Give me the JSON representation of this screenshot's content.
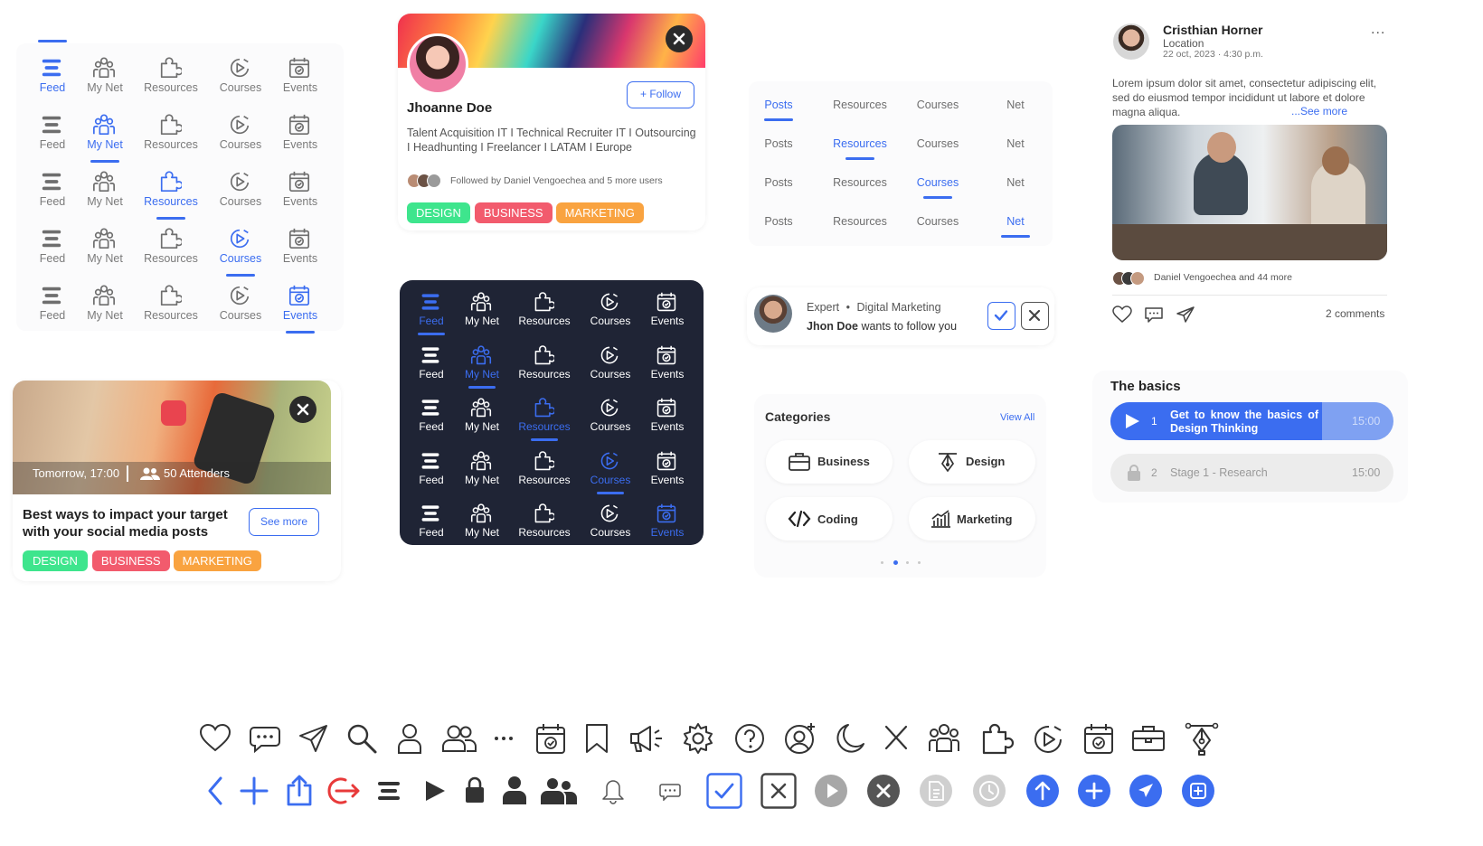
{
  "nav": {
    "labels": [
      "Feed",
      "My Net",
      "Resources",
      "Courses",
      "Events"
    ]
  },
  "profile": {
    "name": "Jhoanne Doe",
    "follow_label": "+ Follow",
    "bio": "Talent Acquisition IT I Technical Recruiter IT I Outsourcing I Headhunting I Freelancer I LATAM I Europe",
    "followed_by": "Followed by Daniel Vengoechea and 5 more users",
    "tags": [
      "DESIGN",
      "BUSINESS",
      "MARKETING"
    ]
  },
  "tabs": {
    "labels": [
      "Posts",
      "Resources",
      "Courses",
      "Net"
    ]
  },
  "follow_request": {
    "role": "Expert",
    "field": "Digital Marketing",
    "name": "Jhon Doe",
    "text": "wants to follow you"
  },
  "categories": {
    "title": "Categories",
    "view_all": "View All",
    "items": [
      "Business",
      "Design",
      "Coding",
      "Marketing"
    ]
  },
  "event": {
    "when": "Tomorrow, 17:00",
    "attendees": "50 Attenders",
    "title": "Best ways to impact your target with your social media posts",
    "see_more": "See more",
    "tags": [
      "DESIGN",
      "BUSINESS",
      "MARKETING"
    ]
  },
  "post": {
    "author": "Cristhian Horner",
    "location": "Location",
    "date": "22 oct, 2023 · 4:30 p.m.",
    "body": "Lorem ipsum dolor sit amet, consectetur adipiscing elit, sed do eiusmod tempor incididunt ut labore et dolore magna aliqua.",
    "see_more": "...See more",
    "likes": "Daniel Vengoechea and 44 more",
    "comments": "2 comments",
    "menu": "..."
  },
  "basics": {
    "title": "The basics",
    "items": [
      {
        "num": "1",
        "label": "Get to know the basics of Design Thinking",
        "time": "15:00"
      },
      {
        "num": "2",
        "label": "Stage 1 - Research",
        "time": "15:00"
      }
    ]
  },
  "colors": {
    "accent": "#3b6df0",
    "dark": "#1f2435",
    "green": "#3ee58d",
    "red": "#f25b6d",
    "orange": "#f9a340"
  }
}
